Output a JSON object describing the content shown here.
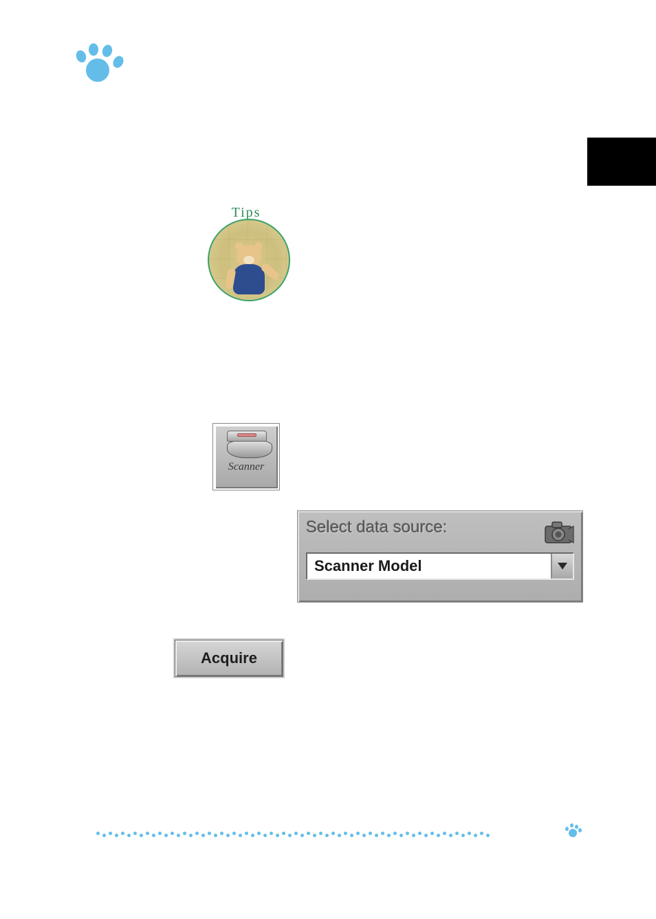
{
  "tips": {
    "label": "Tips"
  },
  "scanner": {
    "label": "Scanner"
  },
  "data_source": {
    "title": "Select data source:",
    "selected": "Scanner Model"
  },
  "acquire": {
    "label": "Acquire"
  },
  "icons": {
    "paw": "paw-icon",
    "camera": "camera-icon",
    "dropdown": "chevron-down-icon",
    "small_paw": "paw-icon"
  }
}
